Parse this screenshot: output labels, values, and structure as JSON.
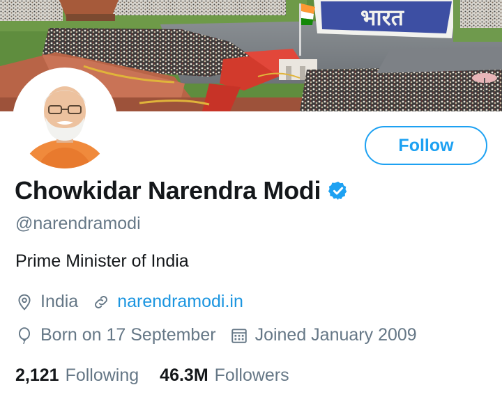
{
  "profile": {
    "display_name": "Chowkidar Narendra Modi",
    "handle": "@narendramodi",
    "bio": "Prime Minister of India",
    "verified": true
  },
  "actions": {
    "follow_label": "Follow"
  },
  "meta": {
    "location": "India",
    "website": "narendramodi.in",
    "birthday": "Born on 17 September",
    "joined": "Joined January 2009"
  },
  "stats": {
    "following_count": "2,121",
    "following_label": "Following",
    "followers_count": "46.3M",
    "followers_label": "Followers"
  },
  "banner": {
    "ground_text": "भारत"
  },
  "colors": {
    "accent": "#1da1f2",
    "link": "#1b95e0",
    "secondary_text": "#657786",
    "primary_text": "#14171a"
  },
  "icons": [
    "verified-badge-icon",
    "location-pin-icon",
    "link-icon",
    "balloon-icon",
    "calendar-icon"
  ]
}
